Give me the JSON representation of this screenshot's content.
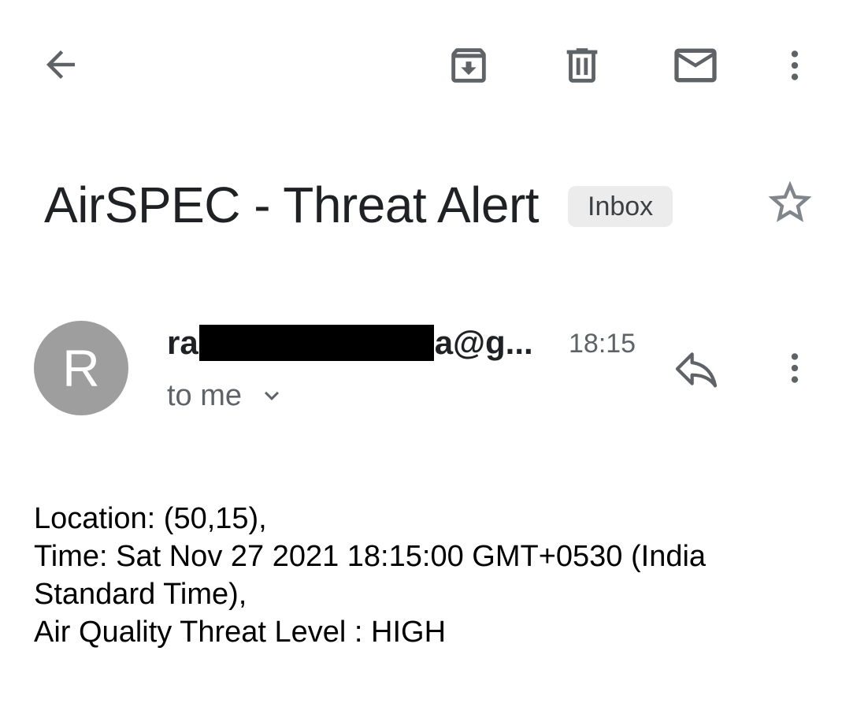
{
  "toolbar": {
    "back_icon": "arrow-left-icon",
    "archive_icon": "archive-icon",
    "delete_icon": "trash-icon",
    "mark_unread_icon": "envelope-icon",
    "more_icon": "more-vert-icon"
  },
  "message": {
    "subject": "AirSPEC - Threat Alert",
    "label": "Inbox",
    "star_icon": "star-outline-icon",
    "avatar_letter": "R",
    "sender_prefix": "ra",
    "sender_suffix": "a@g...",
    "time": "18:15",
    "recipient": "to me",
    "reply_icon": "reply-icon",
    "more_icon": "more-vert-icon"
  },
  "body": {
    "lines": [
      "Location: (50,15),",
      "Time: Sat Nov 27 2021 18:15:00 GMT+0530 (India",
      "Standard Time),",
      "Air Quality Threat Level : HIGH"
    ]
  },
  "colors": {
    "icon": "#5f6368",
    "avatar_bg": "#9e9e9e",
    "chip_bg": "#ececec"
  }
}
